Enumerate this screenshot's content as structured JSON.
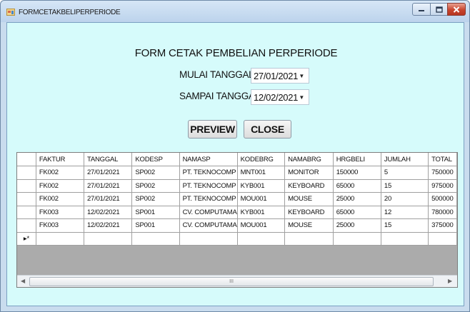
{
  "window": {
    "title": "FORMCETAKBELIPERPERIODE",
    "controls": [
      "minimize-icon",
      "maximize-icon",
      "close-icon"
    ],
    "close_color": "#c8452e"
  },
  "form": {
    "heading": "FORM CETAK PEMBELIAN PERPERIODE",
    "start_label": "MULAI TANGGAL",
    "start_value": "27/01/2021",
    "end_label": "SAMPAI TANGGAL",
    "end_value": "12/02/2021",
    "preview_label": "PREVIEW",
    "close_label": "CLOSE",
    "background_color": "#d6fbfb"
  },
  "grid": {
    "columns": [
      "FAKTUR",
      "TANGGAL",
      "KODESP",
      "NAMASP",
      "KODEBRG",
      "NAMABRG",
      "HRGBELI",
      "JUMLAH",
      "TOTAL"
    ],
    "rows": [
      [
        "FK002",
        "27/01/2021",
        "SP002",
        "PT. TEKNOCOMP",
        "MNT001",
        "MONITOR",
        "150000",
        "5",
        "750000"
      ],
      [
        "FK002",
        "27/01/2021",
        "SP002",
        "PT. TEKNOCOMP",
        "KYB001",
        "KEYBOARD",
        "65000",
        "15",
        "975000"
      ],
      [
        "FK002",
        "27/01/2021",
        "SP002",
        "PT. TEKNOCOMP",
        "MOU001",
        "MOUSE",
        "25000",
        "20",
        "500000"
      ],
      [
        "FK003",
        "12/02/2021",
        "SP001",
        "CV. COMPUTAMA",
        "KYB001",
        "KEYBOARD",
        "65000",
        "12",
        "780000"
      ],
      [
        "FK003",
        "12/02/2021",
        "SP001",
        "CV. COMPUTAMA",
        "MOU001",
        "MOUSE",
        "25000",
        "15",
        "375000"
      ]
    ],
    "new_row_marker": "▸*",
    "scroll_label": "III"
  }
}
